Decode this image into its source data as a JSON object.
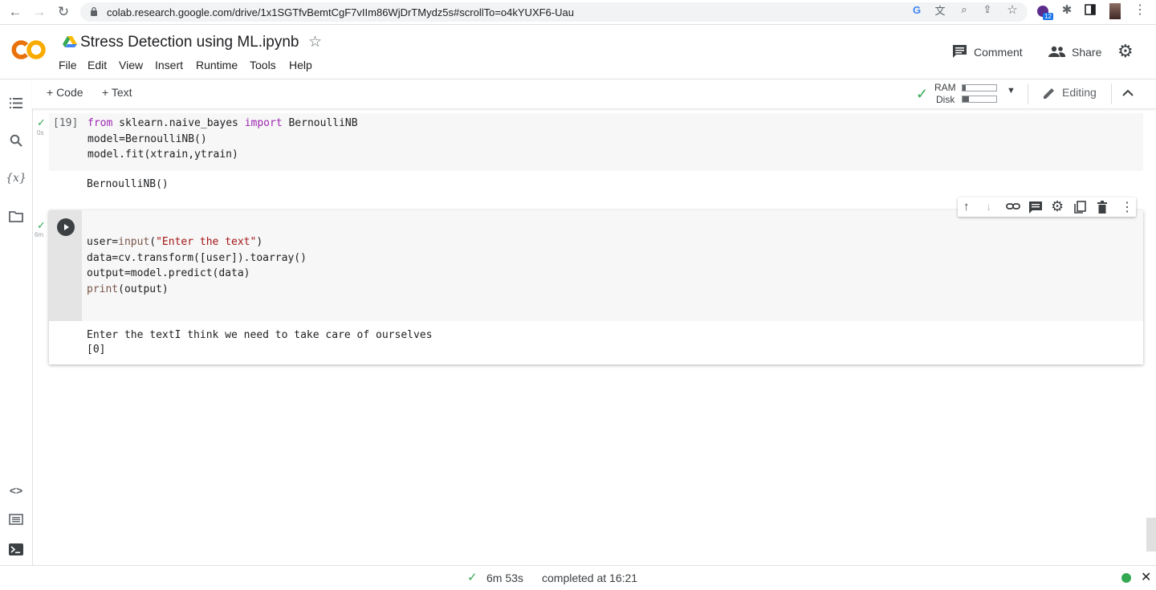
{
  "browser": {
    "url": "colab.research.google.com/drive/1x1SGTfvBemtCgF7vIIm86WjDrTMydz5s#scrollTo=o4kYUXF6-Uau",
    "extension_badge": "12"
  },
  "header": {
    "logo_text": "CO",
    "title": "Stress Detection using ML.ipynb",
    "menu": [
      "File",
      "Edit",
      "View",
      "Insert",
      "Runtime",
      "Tools",
      "Help"
    ],
    "comment_label": "Comment",
    "share_label": "Share"
  },
  "toolbar": {
    "add_code_label": "+ Code",
    "add_text_label": "+ Text",
    "ram_label": "RAM",
    "disk_label": "Disk",
    "ram_usage_fraction": 0.1,
    "disk_usage_fraction": 0.18,
    "editing_label": "Editing"
  },
  "cells": [
    {
      "exec_count": "[19]",
      "duration": "0s",
      "code": [
        "from sklearn.naive_bayes import BernoulliNB",
        "model=BernoulliNB()",
        "model.fit(xtrain,ytrain)"
      ],
      "output": "BernoulliNB()"
    },
    {
      "duration": "6m",
      "code": [
        "user=input(\"Enter the text\")",
        "data=cv.transform([user]).toarray()",
        "output=model.predict(data)",
        "print(output)"
      ],
      "output": [
        "Enter the textI think we need to take care of ourselves",
        "[0]"
      ]
    }
  ],
  "status": {
    "duration": "6m 53s",
    "completed": "completed at 16:21"
  },
  "colors": {
    "accent_check": "#34a853",
    "keyword": "#9c27b0",
    "string": "#a31515",
    "logo_orange": "#f9ab00",
    "logo_dark_orange": "#e8710a"
  }
}
